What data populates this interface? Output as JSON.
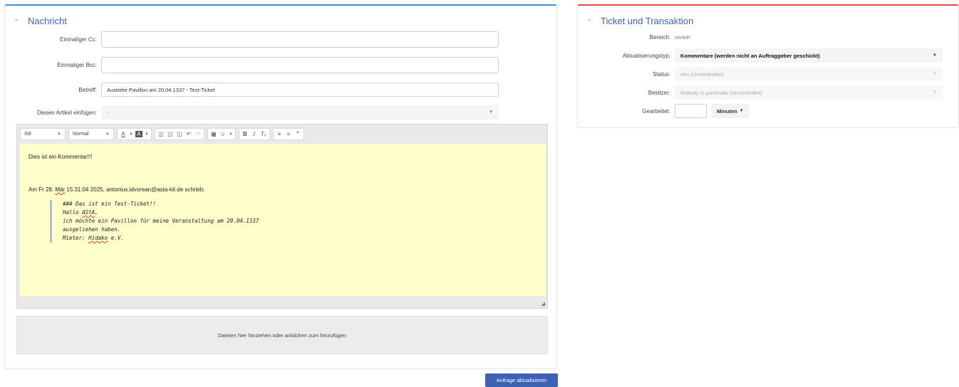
{
  "message": {
    "title": "Nachricht",
    "cc_label": "Einmaliger Cc:",
    "cc_value": "",
    "bcc_label": "Einmaliger Bcc:",
    "bcc_value": "",
    "subject_label": "Betreff:",
    "subject_value": "Ausleihe Pavillon am 20.04.1337 - Test-Ticket",
    "insert_label": "Diesen Artikel einfügen:",
    "insert_value": "-"
  },
  "toolbar": {
    "style_label": "Stil",
    "format_label": "Normal"
  },
  "editor": {
    "line1": "Dies ist ein Kommentar!!!",
    "reply_pre": "Am Fr 28. ",
    "reply_month": "Mär",
    "reply_post": " 15:31:04 2025, antonius.idvorean@asta-kit.de schrieb:",
    "q1": "### Das ist ein Test-Ticket!!",
    "q2_pre": "Hallo ",
    "q2_name": "AStA",
    "q2_post": ",",
    "q3a": "ich möchte ein Pavillon für meine Veranstaltung am 20.04.1337",
    "q3b": "ausgeliehen haben.",
    "q4_pre": "Mieter: ",
    "q4_name": "Hidako",
    "q4_post": " e.V."
  },
  "dropzone_text": "Dateien hier hinziehen oder anklicken zum hinzufügen",
  "submit_label": "Anfrage aktualisieren",
  "ticket": {
    "title": "Ticket und Transaktion",
    "bereich_label": "Bereich:",
    "bereich_value": "verleih",
    "update_type_label": "Aktualisierungstyp:",
    "update_type_value": "Kommentare (werden nicht an Auftraggeber geschickt)",
    "status_label": "Status:",
    "status_value": "neu (Unverändert)",
    "owner_label": "Besitzer:",
    "owner_value": "Nobody in particular (Unverändert)",
    "worked_label": "Gearbeitet:",
    "worked_value": "",
    "unit_label": "Minuten"
  }
}
